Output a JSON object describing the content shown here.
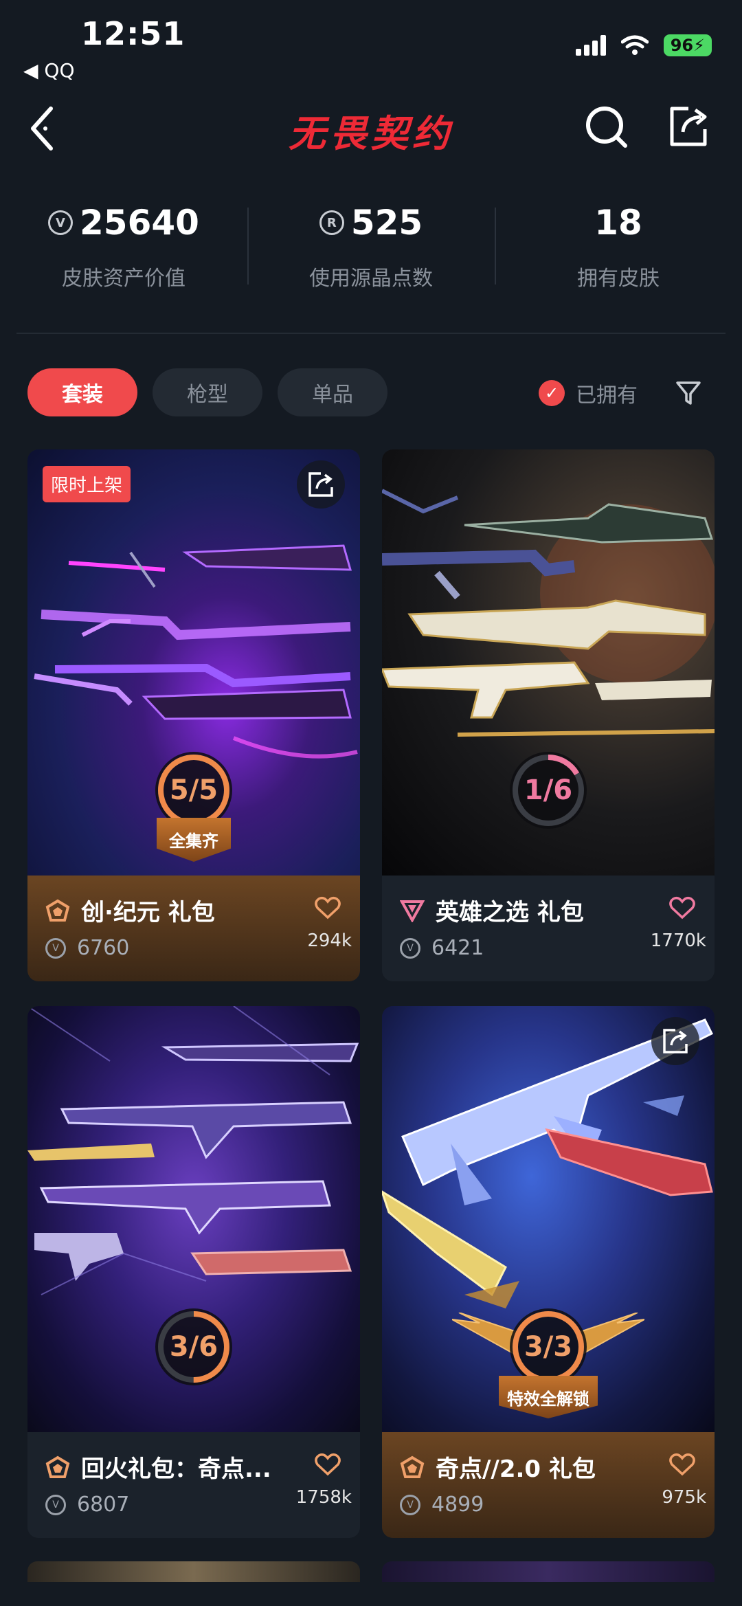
{
  "status_bar": {
    "time": "12:51",
    "back_app": "◀ QQ",
    "battery": "96"
  },
  "header": {
    "title": "无畏契约"
  },
  "stats": [
    {
      "value": "25640",
      "label": "皮肤资产价值",
      "icon": "vp-coin-icon"
    },
    {
      "value": "525",
      "label": "使用源晶点数",
      "icon": "radianite-icon"
    },
    {
      "value": "18",
      "label": "拥有皮肤"
    }
  ],
  "tabs": [
    {
      "label": "套装",
      "active": true
    },
    {
      "label": "枪型",
      "active": false
    },
    {
      "label": "单品",
      "active": false
    }
  ],
  "owned_filter": {
    "label": "已拥有",
    "checked": true
  },
  "cards": [
    {
      "name": "创·纪元 礼包",
      "price": "6760",
      "likes": "294k",
      "progress_label": "5/5",
      "progress_owned": 5,
      "progress_total": 5,
      "ribbon": "全集齐",
      "badge": "限时上架",
      "tier": "gold"
    },
    {
      "name": "英雄之选 礼包",
      "price": "6421",
      "likes": "1770k",
      "progress_label": "1/6",
      "progress_owned": 1,
      "progress_total": 6,
      "tier": "pink"
    },
    {
      "name": "回火礼包：奇点...",
      "price": "6807",
      "likes": "1758k",
      "progress_label": "3/6",
      "progress_owned": 3,
      "progress_total": 6,
      "tier": "gold"
    },
    {
      "name": "奇点//2.0 礼包",
      "price": "4899",
      "likes": "975k",
      "progress_label": "3/3",
      "progress_owned": 3,
      "progress_total": 3,
      "ribbon": "特效全解锁",
      "tier": "gold"
    }
  ],
  "colors": {
    "accent": "#f04a4c",
    "gold": "#f0a06a",
    "pink": "#f07aa0",
    "background": "#141a22"
  }
}
